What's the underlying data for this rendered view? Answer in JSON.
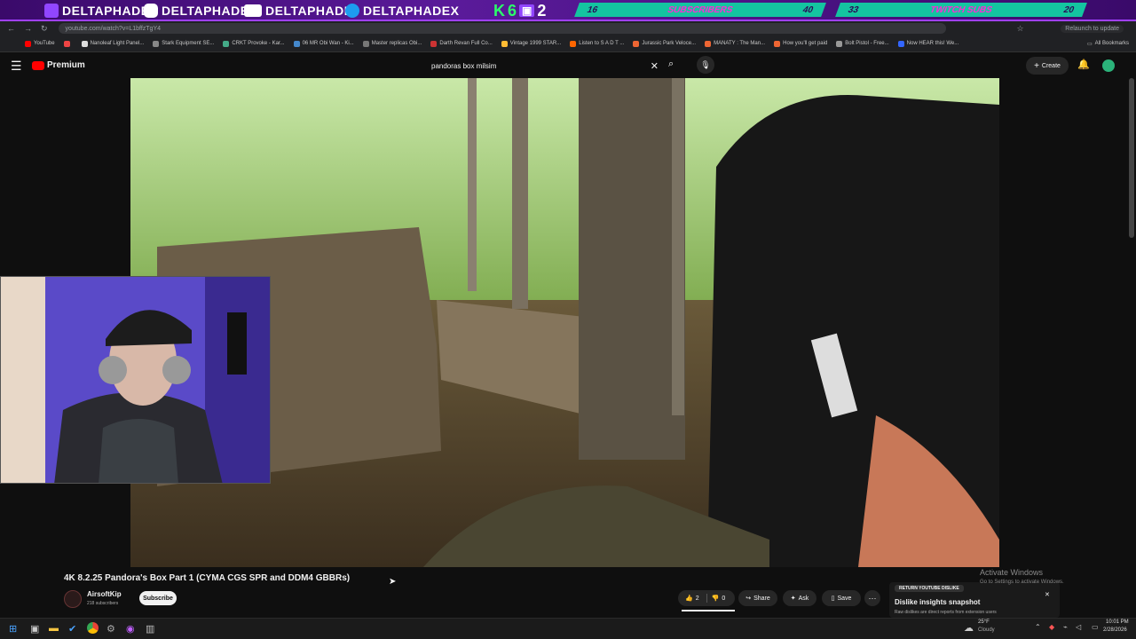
{
  "overlay": {
    "socials": [
      "DELTAPHADE",
      "DELTAPHADE",
      "DELTAPHADE",
      "DELTAPHADEX"
    ],
    "kbox": [
      "K",
      "6",
      "2"
    ],
    "bars": [
      {
        "left_num": "16",
        "title": "SUBSCRIBERS",
        "right_num": "40"
      },
      {
        "left_num": "33",
        "title": "TWITCH SUBS",
        "right_num": "20"
      }
    ]
  },
  "browser": {
    "url": "youtube.com/watch?v=L1bffzTgY4",
    "relaunch": "Relaunch to update",
    "bookmarks": [
      "YouTube",
      "",
      "Nanoleaf Light Panel...",
      "Stark Equipment SE...",
      "CRKT Provoke - Kar...",
      "06 MR Obi Wan - Ki...",
      "Master replicas Obi...",
      "Darth Revan Full Co...",
      "Vintage 1999 STAR...",
      "Listen to S A D T ...",
      "Jurassic Park Veloce...",
      "MANATY : The Man...",
      "How you'll get paid",
      "Bolt Pistol - Free...",
      "Now HEAR this! We..."
    ],
    "all_bookmarks": "All Bookmarks"
  },
  "youtube": {
    "logo": "Premium",
    "search_value": "pandoras box milsim",
    "create": "Create",
    "title": "4K 8.2.25 Pandora's Box Part 1 (CYMA CGS SPR and DDM4 GBBRs)",
    "channel": "AirsoftKip",
    "subs": "218 subscribers",
    "subscribe": "Subscribe",
    "likes": "2",
    "dislikes": "0",
    "share": "Share",
    "ask": "Ask",
    "save": "Save"
  },
  "dislike_popup": {
    "tag": "RETURN YOUTUBE DISLIKE",
    "title": "Dislike insights snapshot",
    "text": "Raw dislikes are direct reports from extension users"
  },
  "activate": {
    "title": "Activate Windows",
    "sub": "Go to Settings to activate Windows."
  },
  "taskbar": {
    "weather_temp": "25°F",
    "weather_desc": "Cloudy",
    "time": "10:01 PM",
    "date": "2/28/2026"
  }
}
